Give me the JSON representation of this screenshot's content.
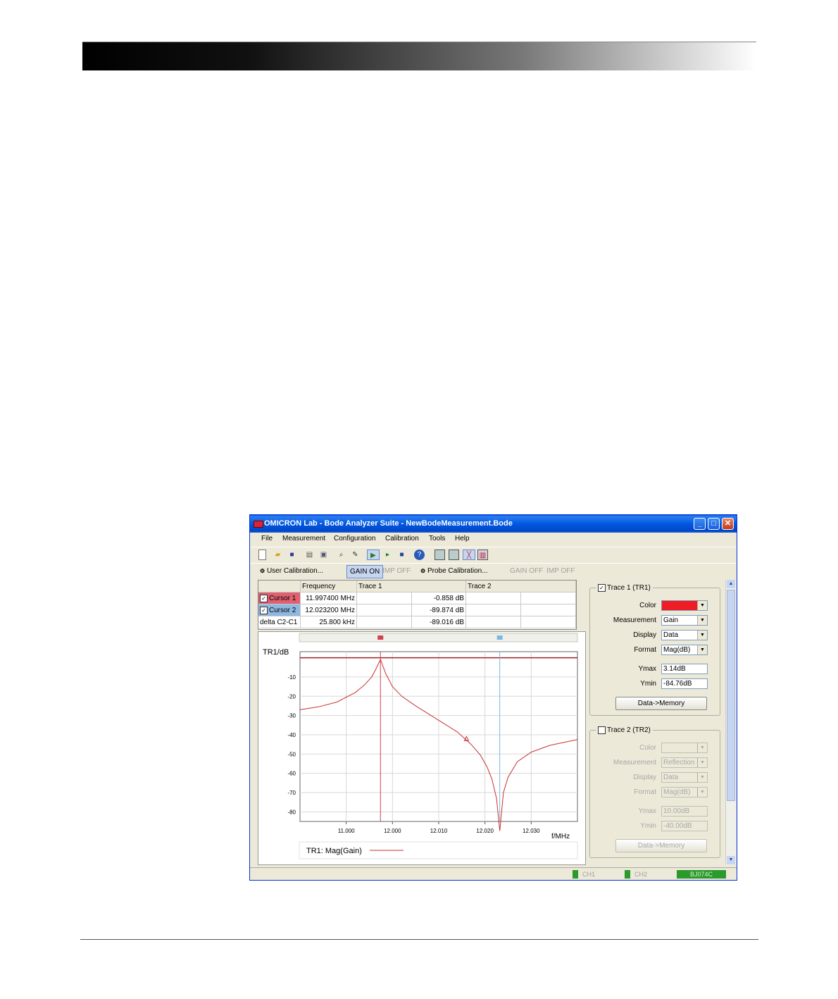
{
  "window": {
    "title": "OMICRON Lab - Bode Analyzer Suite - NewBodeMeasurement.Bode",
    "minimize": "_",
    "maximize": "□",
    "close": "✕"
  },
  "menu": [
    "File",
    "Measurement",
    "Configuration",
    "Calibration",
    "Tools",
    "Help"
  ],
  "toolbar_icons": [
    "new-file-icon",
    "open-folder-icon",
    "save-icon",
    "print-icon",
    "print-preview-icon",
    "zoom-icon",
    "wrench-icon",
    "play-icon",
    "single-sweep-icon",
    "stop-icon",
    "help-icon",
    "layout-1-icon",
    "layout-2-icon",
    "chart-icon",
    "bars-icon"
  ],
  "calbar": {
    "user_cal": "User Calibration...",
    "gain_on": "GAIN ON",
    "imp_off": "IMP OFF",
    "probe_cal": "Probe Calibration...",
    "gain_off": "GAIN OFF",
    "imp_off2": "IMP OFF"
  },
  "cursor_table": {
    "headers": [
      "",
      "Frequency",
      "Trace 1",
      "Trace 2"
    ],
    "rows": [
      {
        "label": "Cursor 1",
        "frequency": "11.997400 MHz",
        "trace1": "-0.858 dB",
        "color": "#e06070"
      },
      {
        "label": "Cursor 2",
        "frequency": "12.023200 MHz",
        "trace1": "-89.874 dB",
        "color": "#8fb8e0"
      },
      {
        "label": "delta C2-C1",
        "frequency": "25.800 kHz",
        "trace1": "-89.016 dB",
        "color": ""
      }
    ]
  },
  "chart_data": {
    "type": "line",
    "ylabel": "TR1/dB",
    "xlabel": "f/MHz",
    "xlim": [
      11.99,
      12.03
    ],
    "ylim": [
      -85,
      3.14
    ],
    "xticks": [
      11.0,
      12.0,
      12.01,
      12.02,
      12.03
    ],
    "xtick_labels": [
      "11.000",
      "12.000",
      "12.010",
      "12.020",
      "12.030"
    ],
    "yticks": [
      -10,
      -20,
      -30,
      -40,
      -50,
      -60,
      -70,
      -80
    ],
    "reference_line_y": 0,
    "cursors": [
      {
        "name": "Cursor 1",
        "x": 11.9974,
        "color": "#d04050"
      },
      {
        "name": "Cursor 2",
        "x": 12.0232,
        "color": "#7ab8e0"
      }
    ],
    "legend": "TR1: Mag(Gain)",
    "series": [
      {
        "name": "TR1: Mag(Gain)",
        "color": "#c83030",
        "x": [
          11.98,
          11.984,
          11.988,
          11.992,
          11.994,
          11.9955,
          11.9965,
          11.9974,
          11.9985,
          12.0,
          12.002,
          12.005,
          12.008,
          12.011,
          12.014,
          12.017,
          12.019,
          12.0205,
          12.0215,
          12.0225,
          12.0232,
          12.024,
          12.025,
          12.027,
          12.03,
          12.034,
          12.04
        ],
        "y": [
          -27,
          -25.5,
          -23,
          -18,
          -14,
          -10,
          -5.5,
          -0.9,
          -8,
          -15,
          -20,
          -25,
          -29.5,
          -34,
          -38.5,
          -45,
          -50.5,
          -57,
          -63,
          -73,
          -89.9,
          -70,
          -62,
          -54,
          -49,
          -45.5,
          -42.5
        ]
      }
    ]
  },
  "panel": {
    "trace1": {
      "checked": true,
      "title": "Trace 1 (TR1)",
      "color_label": "Color",
      "color": "#ee1c24",
      "measurement_label": "Measurement",
      "measurement": "Gain",
      "display_label": "Display",
      "display": "Data",
      "format_label": "Format",
      "format": "Mag(dB)",
      "ymax_label": "Ymax",
      "ymax": "3.14dB",
      "ymin_label": "Ymin",
      "ymin": "-84.76dB",
      "button": "Data->Memory"
    },
    "trace2": {
      "checked": false,
      "title": "Trace 2 (TR2)",
      "color_label": "Color",
      "color": "#ece9d8",
      "measurement_label": "Measurement",
      "measurement": "Reflection",
      "display_label": "Display",
      "display": "Data",
      "format_label": "Format",
      "format": "Mag(dB)",
      "ymax_label": "Ymax",
      "ymax": "10.00dB",
      "ymin_label": "Ymin",
      "ymin": "-40.00dB",
      "button": "Data->Memory"
    }
  },
  "status": {
    "ch1": "CH1",
    "ch2": "CH2",
    "device": "BJ074C"
  }
}
